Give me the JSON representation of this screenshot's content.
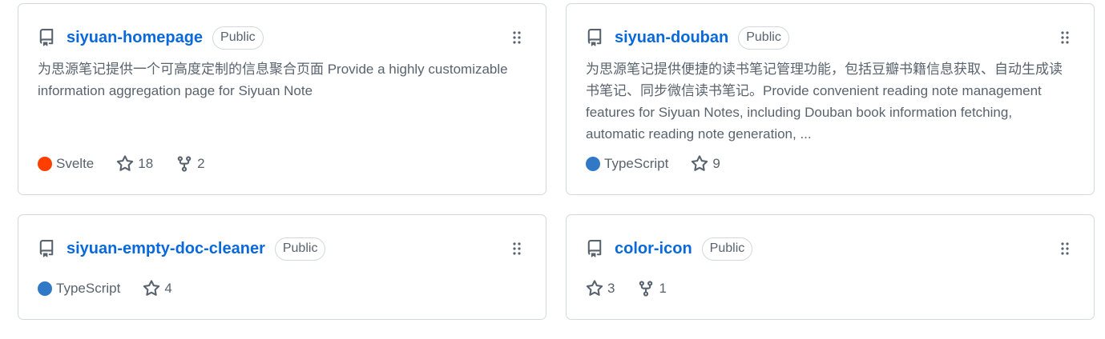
{
  "repos": [
    {
      "name": "siyuan-homepage",
      "visibility": "Public",
      "description": "为思源笔记提供一个可高度定制的信息聚合页面 Provide a highly customizable information aggregation page for Siyuan Note",
      "language": "Svelte",
      "language_color": "#ff3e00",
      "stars": "18",
      "forks": "2"
    },
    {
      "name": "siyuan-douban",
      "visibility": "Public",
      "description": "为思源笔记提供便捷的读书笔记管理功能，包括豆瓣书籍信息获取、自动生成读书笔记、同步微信读书笔记。Provide convenient reading note management features for Siyuan Notes, including Douban book information fetching, automatic reading note generation, ...",
      "language": "TypeScript",
      "language_color": "#3178c6",
      "stars": "9"
    },
    {
      "name": "siyuan-empty-doc-cleaner",
      "visibility": "Public",
      "language": "TypeScript",
      "language_color": "#3178c6",
      "stars": "4"
    },
    {
      "name": "color-icon",
      "visibility": "Public",
      "stars": "3",
      "forks": "1"
    }
  ],
  "icons": {
    "repo": "repo-icon",
    "drag": "grabber-icon",
    "star": "star-icon",
    "fork": "fork-icon"
  }
}
